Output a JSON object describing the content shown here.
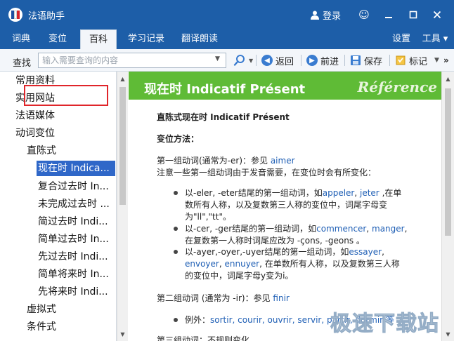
{
  "window": {
    "title": "法语助手",
    "login_label": "登录",
    "colors": {
      "title_bar": "#1d5ea8",
      "header_green": "#5fbb36",
      "selection": "#2f67c8",
      "highlight_box": "#e0252a"
    }
  },
  "menu": {
    "tabs": [
      "词典",
      "变位",
      "百科",
      "学习记录",
      "翻译朗读"
    ],
    "active": "百科",
    "settings": "设置",
    "tools": "工具 ▾"
  },
  "toolbar": {
    "search_label": "查找",
    "search_placeholder": "输入需要查询的内容",
    "back": "返回",
    "forward": "前进",
    "save": "保存",
    "mark": "标记"
  },
  "sidebar": {
    "items": [
      "常用资料",
      "实用网站",
      "法语媒体",
      "动词变位",
      "直陈式",
      "现在时 Indica...",
      "复合过去时 In...",
      "未完成过去时 ...",
      "简过去时 Indi...",
      "简单过去时 In...",
      "先过去时 Indi...",
      "简单将来时 In...",
      "先将来时 Indi...",
      "虚拟式",
      "条件式"
    ],
    "selected_index": 5
  },
  "content": {
    "header_title": "现在时 Indicatif Présent",
    "header_ref": "Référence",
    "heading": "直陈式现在时 Indicatif Présent",
    "method_label": "变位方法：",
    "group1": {
      "text": "第一组动词(通常为-er)：参见 ",
      "link": "aimer"
    },
    "note": "注意一些第一组动词由于发音需要，在变位时会有所变化：",
    "bullets": [
      {
        "l1_pre": "以-eler, -eter结尾的第一组动词，如",
        "l1_link1": "appeler",
        "l1_mid": ", ",
        "l1_link2": "jeter",
        "l1_post": " ,在单",
        "l2": "数所有人称，以及复数第三人称的变位中，词尾字母变",
        "l3": "为\"ll\",\"tt\"。"
      },
      {
        "l1_pre": "以-cer, -ger结尾的第一组动词，如",
        "l1_link1": "commencer",
        "l1_mid": ", ",
        "l1_link2": "manger",
        "l1_post": ",",
        "l2": "在复数第一人称时词尾应改为 -çons, -geons 。"
      },
      {
        "l1_pre": "以-ayer,-oyer,-uyer结尾的第一组动词，如",
        "l1_link1": "essayer",
        "l1_post": ",",
        "l2_link1": "envoyer",
        "l2_mid": ", ",
        "l2_link2": "ennuyer",
        "l2_post": ", 在单数所有人称，以及复数第三人称",
        "l3": "的变位中，词尾字母y变为i。"
      }
    ],
    "group2": {
      "text": "第二组动词 (通常为 -ir)：参见 ",
      "link": "finir"
    },
    "example_label": "例外：",
    "examples": "sortir, courir, ouvrir, servir, partir, dormir 等",
    "group3": "第三组动词：不规则变化"
  },
  "watermark": "极速下载站"
}
